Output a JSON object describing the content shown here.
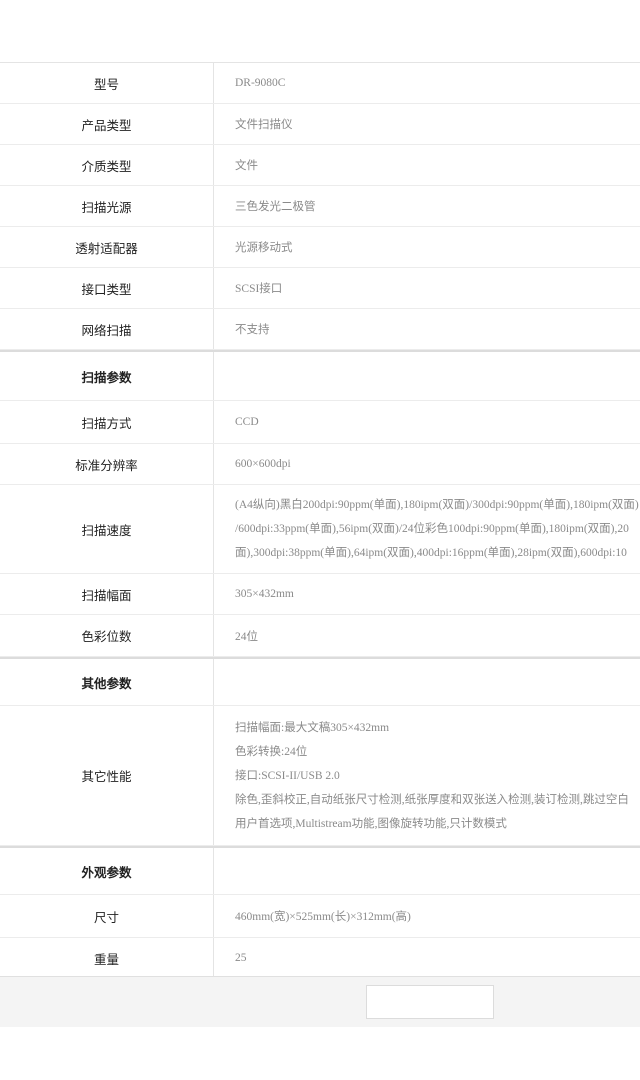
{
  "basic": [
    {
      "label": "型号",
      "value": "DR-9080C"
    },
    {
      "label": "产品类型",
      "value": "文件扫描仪"
    },
    {
      "label": "介质类型",
      "value": "文件"
    },
    {
      "label": "扫描光源",
      "value": "三色发光二极管"
    },
    {
      "label": "透射适配器",
      "value": "光源移动式"
    },
    {
      "label": "接口类型",
      "value": "SCSI接口"
    },
    {
      "label": "网络扫描",
      "value": "不支持"
    }
  ],
  "scan_section": {
    "title": "扫描参数",
    "method_label": "扫描方式",
    "method_value": "CCD",
    "resolution_label": "标准分辨率",
    "resolution_value": "600×600dpi",
    "speed_label": "扫描速度",
    "speed_lines": [
      "(A4纵向)黑白200dpi:90ppm(单面),180ipm(双面)/300dpi:90ppm(单面),180ipm(双面)",
      "/600dpi:33ppm(单面),56ipm(双面)/24位彩色100dpi:90ppm(单面),180ipm(双面),20",
      "面),300dpi:38ppm(单面),64ipm(双面),400dpi:16ppm(单面),28ipm(双面),600dpi:10"
    ],
    "width_label": "扫描幅面",
    "width_value": "305×432mm",
    "color_label": "色彩位数",
    "color_value": "24位"
  },
  "other_section": {
    "title": "其他参数",
    "perf_label": "其它性能",
    "perf_lines": [
      "扫描幅面:最大文稿305×432mm",
      "色彩转换:24位",
      "接口:SCSI-II/USB 2.0",
      "除色,歪斜校正,自动纸张尺寸检测,纸张厚度和双张送入检测,装订检测,跳过空白",
      "用户首选项,Multistream功能,图像旋转功能,只计数模式"
    ]
  },
  "appearance_section": {
    "title": "外观参数",
    "size_label": "尺寸",
    "size_value": "460mm(宽)×525mm(长)×312mm(高)",
    "weight_label": "重量",
    "weight_value": "25"
  }
}
